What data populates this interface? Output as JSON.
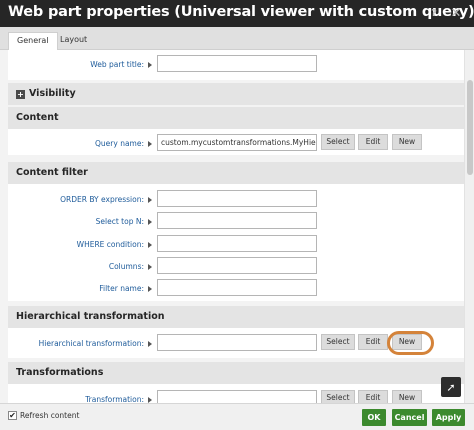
{
  "window": {
    "title": "Web part properties (Universal viewer with custom query)",
    "help_icon": "help-icon",
    "close_icon": "close-icon"
  },
  "tabs": [
    {
      "label": "General",
      "active": true
    },
    {
      "label": "Layout",
      "active": false
    }
  ],
  "general": {
    "web_part_title_label": "Web part title:",
    "web_part_title_value": ""
  },
  "visibility": {
    "header": "Visibility",
    "expand_symbol": "+"
  },
  "content_section": {
    "header": "Content",
    "query_name_label": "Query name:",
    "query_name_value": "custom.mycustomtransformations.MyHierarchica",
    "select_label": "Select",
    "edit_label": "Edit",
    "new_label": "New"
  },
  "content_filter": {
    "header": "Content filter",
    "fields": [
      {
        "label": "ORDER BY expression:",
        "value": ""
      },
      {
        "label": "Select top N:",
        "value": ""
      },
      {
        "label": "WHERE condition:",
        "value": ""
      },
      {
        "label": "Columns:",
        "value": ""
      },
      {
        "label": "Filter name:",
        "value": ""
      }
    ]
  },
  "hierarchical_transformation": {
    "header": "Hierarchical transformation",
    "label": "Hierarchical transformation:",
    "value": "",
    "select_label": "Select",
    "edit_label": "Edit",
    "new_label": "New"
  },
  "transformations": {
    "header": "Transformations",
    "transformation_label": "Transformation:",
    "select_label": "Select",
    "edit_label": "Edit",
    "new_label": "New"
  },
  "footer": {
    "refresh_content_label": "Refresh content",
    "refresh_content_checked": true,
    "ok_label": "OK",
    "cancel_label": "Cancel",
    "apply_label": "Apply"
  },
  "colors": {
    "titlebar": "#262626",
    "link_label": "#1e5b9a",
    "primary_button": "#3c8a2e",
    "highlight": "#d4833a"
  }
}
